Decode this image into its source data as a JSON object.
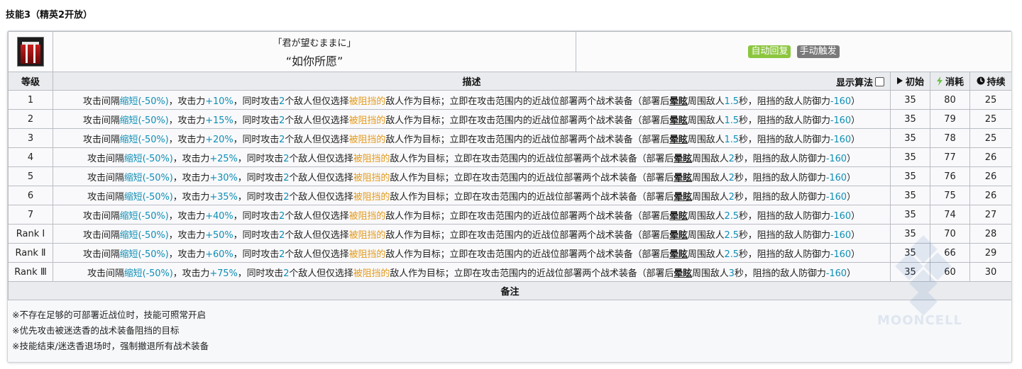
{
  "heading": "技能3（精英2开放）",
  "skill": {
    "icon": "sword-skill-icon",
    "name_jp": "「君が望むままに」",
    "name_cn": "“如你所愿”",
    "tags": [
      "自动回复",
      "手动触发"
    ],
    "tag_colors": {
      "auto": "#8cc63f",
      "manual": "#7a7a7a"
    }
  },
  "headers": {
    "level": "等级",
    "desc": "描述",
    "algo": "显示算法",
    "init": "初始",
    "cost": "消耗",
    "duration": "持续"
  },
  "rows": [
    {
      "level": "1",
      "interval": "缩短(-50%)",
      "atk": "+10%",
      "targets": "2",
      "stun": "1.5",
      "def": "-160",
      "init": "35",
      "cost": "80",
      "dur": "25"
    },
    {
      "level": "2",
      "interval": "缩短(-50%)",
      "atk": "+15%",
      "targets": "2",
      "stun": "1.5",
      "def": "-160",
      "init": "35",
      "cost": "79",
      "dur": "25"
    },
    {
      "level": "3",
      "interval": "缩短(-50%)",
      "atk": "+20%",
      "targets": "2",
      "stun": "1.5",
      "def": "-160",
      "init": "35",
      "cost": "78",
      "dur": "25"
    },
    {
      "level": "4",
      "interval": "缩短(-50%)",
      "atk": "+25%",
      "targets": "2",
      "stun": "2",
      "def": "-160",
      "init": "35",
      "cost": "77",
      "dur": "26"
    },
    {
      "level": "5",
      "interval": "缩短(-50%)",
      "atk": "+30%",
      "targets": "2",
      "stun": "2",
      "def": "-160",
      "init": "35",
      "cost": "76",
      "dur": "26"
    },
    {
      "level": "6",
      "interval": "缩短(-50%)",
      "atk": "+35%",
      "targets": "2",
      "stun": "2",
      "def": "-160",
      "init": "35",
      "cost": "75",
      "dur": "26"
    },
    {
      "level": "7",
      "interval": "缩短(-50%)",
      "atk": "+40%",
      "targets": "2",
      "stun": "2.5",
      "def": "-160",
      "init": "35",
      "cost": "74",
      "dur": "27"
    },
    {
      "level": "Rank Ⅰ",
      "interval": "缩短(-50%)",
      "atk": "+50%",
      "targets": "2",
      "stun": "2.5",
      "def": "-160",
      "init": "35",
      "cost": "70",
      "dur": "28"
    },
    {
      "level": "Rank Ⅱ",
      "interval": "缩短(-50%)",
      "atk": "+60%",
      "targets": "2",
      "stun": "2.5",
      "def": "-160",
      "init": "35",
      "cost": "66",
      "dur": "29"
    },
    {
      "level": "Rank Ⅲ",
      "interval": "缩短(-50%)",
      "atk": "+75%",
      "targets": "2",
      "stun": "3",
      "def": "-160",
      "init": "35",
      "cost": "60",
      "dur": "30"
    }
  ],
  "desc_parts": {
    "p1": "攻击间隔",
    "p2": "，攻击力",
    "p3": "，同时攻击",
    "p4": "个敌人但仅选择",
    "blocked": "被阻挡的",
    "p5": "敌人作为目标；立即在攻击范围内的近战位部署两个战术装备（部署后",
    "stun_word": "晕眩",
    "p6": "周围敌人",
    "p7": "秒，阻挡的敌人防御力",
    "p8": "）"
  },
  "notes_head": "备注",
  "notes": [
    "※不存在足够的可部署近战位时，技能可照常开启",
    "※优先攻击被迷迭香的战术装备阻挡的目标",
    "※技能结束/迷迭香退场时，强制撤退所有战术装备"
  ],
  "watermark": "MOONCELL"
}
